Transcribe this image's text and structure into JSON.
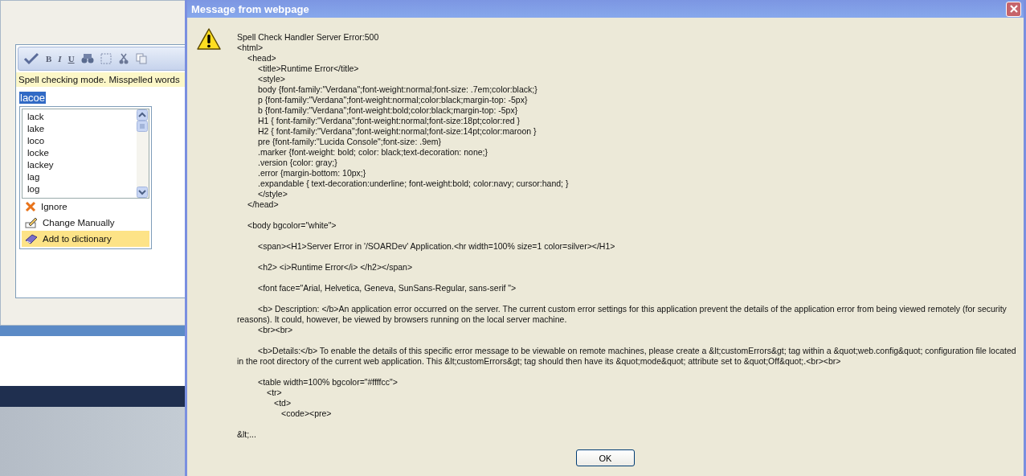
{
  "editor": {
    "toolbar_buttons": [
      "B",
      "I",
      "U"
    ],
    "status_message": "Spell checking mode. Misspelled words",
    "misspelled_word": {
      "text": "lacoe",
      "selected": true
    },
    "suggestions": [
      "lack",
      "lake",
      "loco",
      "locke",
      "lackey",
      "lag",
      "log"
    ],
    "actions": [
      {
        "label": "Ignore",
        "kind": "ignore",
        "selected": false
      },
      {
        "label": "Change Manually",
        "kind": "edit",
        "selected": false
      },
      {
        "label": "Add to dictionary",
        "kind": "dictionary",
        "selected": true
      }
    ]
  },
  "dialog": {
    "title": "Message from webpage",
    "lines": [
      {
        "text": "Spell Check Handler Server Error:500",
        "space_before": false
      },
      {
        "text": "<html>",
        "space_before": false,
        "children": [
          {
            "text": "<head>",
            "space_before": false,
            "children": [
              {
                "text": "<title>Runtime Error</title>",
                "space_before": false
              },
              {
                "text": "<style>",
                "space_before": false
              },
              {
                "text": "body {font-family:\"Verdana\";font-weight:normal;font-size: .7em;color:black;}",
                "space_before": false
              },
              {
                "text": "p {font-family:\"Verdana\";font-weight:normal;color:black;margin-top: -5px}",
                "space_before": false
              },
              {
                "text": "b {font-family:\"Verdana\";font-weight:bold;color:black;margin-top: -5px}",
                "space_before": false
              },
              {
                "text": "H1 { font-family:\"Verdana\";font-weight:normal;font-size:18pt;color:red }",
                "space_before": false
              },
              {
                "text": "H2 { font-family:\"Verdana\";font-weight:normal;font-size:14pt;color:maroon }",
                "space_before": false
              },
              {
                "text": "pre {font-family:\"Lucida Console\";font-size: .9em}",
                "space_before": false
              },
              {
                "text": ".marker {font-weight: bold; color: black;text-decoration: none;}",
                "space_before": false
              },
              {
                "text": ".version {color: gray;}",
                "space_before": false
              },
              {
                "text": ".error {margin-bottom: 10px;}",
                "space_before": false
              },
              {
                "text": ".expandable { text-decoration:underline; font-weight:bold; color:navy; cursor:hand; }",
                "space_before": false
              },
              {
                "text": "</style>",
                "space_before": false
              }
            ]
          },
          {
            "text": "</head>",
            "space_before": false
          },
          {
            "text": "<body bgcolor=\"white\">",
            "space_before": true,
            "children": [
              {
                "text": "<span><H1>Server Error in '/SOARDev' Application.<hr width=100% size=1 color=silver></H1>",
                "space_before": true
              },
              {
                "text": "<h2> <i>Runtime Error</i> </h2></span>",
                "space_before": true
              },
              {
                "text": "<font face=\"Arial, Helvetica, Geneva, SunSans-Regular, sans-serif \">",
                "space_before": true
              },
              {
                "text": "<b> Description: </b>An application error occurred on the server. The current custom error settings for this application prevent the details of the application error from being viewed remotely (for security reasons). It could, however, be viewed by browsers running on the local server machine.",
                "space_before": true
              },
              {
                "text": "<br><br>",
                "space_before": false
              },
              {
                "text": "<b>Details:</b> To enable the details of this specific error message to be viewable on remote machines, please create a &lt;customErrors&gt; tag within a &quot;web.config&quot; configuration file located in the root directory of the current web application. This &lt;customErrors&gt; tag should then have its &quot;mode&quot; attribute set to &quot;Off&quot;.<br><br>",
                "space_before": true
              },
              {
                "text": "<table width=100% bgcolor=\"#ffffcc\">",
                "space_before": true,
                "children": [
                  {
                    "text": "<tr>",
                    "space_before": false,
                    "children": [
                      {
                        "text": "<td>",
                        "space_before": false,
                        "children": [
                          {
                            "text": "<code><pre>",
                            "space_before": false
                          }
                        ]
                      }
                    ]
                  }
                ]
              }
            ]
          }
        ]
      },
      {
        "text": "&lt;...",
        "space_before": true
      }
    ],
    "buttons": [
      "OK"
    ]
  }
}
